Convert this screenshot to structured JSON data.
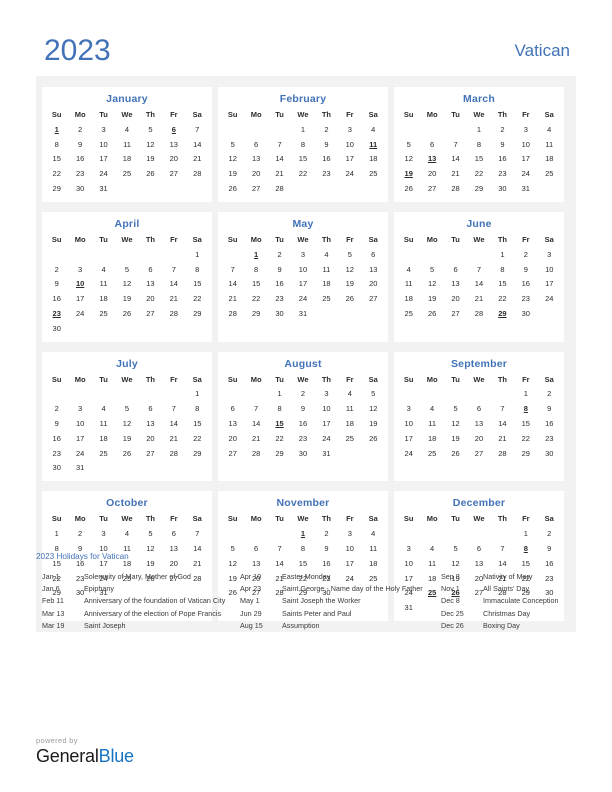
{
  "header": {
    "year": "2023",
    "country": "Vatican"
  },
  "colors": {
    "accent_blue": "#4272b8",
    "holiday_red": "#e3000f",
    "panel_bg": "#f2f2f2",
    "card_bg": "#ffffff",
    "brand_blue": "#1673c4"
  },
  "weekdays": [
    "Su",
    "Mo",
    "Tu",
    "We",
    "Th",
    "Fr",
    "Sa"
  ],
  "months": [
    {
      "name": "January",
      "lead_blanks": 0,
      "days": 31,
      "holidays": [
        1,
        6
      ]
    },
    {
      "name": "February",
      "lead_blanks": 3,
      "days": 28,
      "holidays": [
        11
      ]
    },
    {
      "name": "March",
      "lead_blanks": 3,
      "days": 31,
      "holidays": [
        13,
        19
      ]
    },
    {
      "name": "April",
      "lead_blanks": 6,
      "days": 30,
      "holidays": [
        10,
        23
      ]
    },
    {
      "name": "May",
      "lead_blanks": 1,
      "days": 31,
      "holidays": [
        1
      ]
    },
    {
      "name": "June",
      "lead_blanks": 4,
      "days": 30,
      "holidays": [
        29
      ]
    },
    {
      "name": "July",
      "lead_blanks": 6,
      "days": 31,
      "holidays": []
    },
    {
      "name": "August",
      "lead_blanks": 2,
      "days": 31,
      "holidays": [
        15
      ]
    },
    {
      "name": "September",
      "lead_blanks": 5,
      "days": 30,
      "holidays": [
        8
      ]
    },
    {
      "name": "October",
      "lead_blanks": 0,
      "days": 31,
      "holidays": []
    },
    {
      "name": "November",
      "lead_blanks": 3,
      "days": 30,
      "holidays": [
        1
      ]
    },
    {
      "name": "December",
      "lead_blanks": 5,
      "days": 31,
      "holidays": [
        8,
        25,
        26
      ]
    }
  ],
  "holidays_section": {
    "title": "2023 Holidays for Vatican",
    "columns": [
      [
        {
          "date": "Jan 1",
          "name": "Solemnity of Mary, Mother of God"
        },
        {
          "date": "Jan 6",
          "name": "Epiphany"
        },
        {
          "date": "Feb 11",
          "name": "Anniversary of the foundation of Vatican City"
        },
        {
          "date": "Mar 13",
          "name": "Anniversary of the election of Pope Francis"
        },
        {
          "date": "Mar 19",
          "name": "Saint Joseph"
        }
      ],
      [
        {
          "date": "Apr 10",
          "name": "Easter Monday"
        },
        {
          "date": "Apr 23",
          "name": "Saint George - Name day of the Holy Father"
        },
        {
          "date": "May 1",
          "name": "Saint Joseph the Worker"
        },
        {
          "date": "Jun 29",
          "name": "Saints Peter and Paul"
        },
        {
          "date": "Aug 15",
          "name": "Assumption"
        }
      ],
      [
        {
          "date": "Sep 8",
          "name": "Nativity of Mary"
        },
        {
          "date": "Nov 1",
          "name": "All Saints’ Day"
        },
        {
          "date": "Dec 8",
          "name": "Immaculate Conception"
        },
        {
          "date": "Dec 25",
          "name": "Christmas Day"
        },
        {
          "date": "Dec 26",
          "name": "Boxing Day"
        }
      ]
    ]
  },
  "footer": {
    "powered_by": "powered by",
    "brand_first": "General",
    "brand_second": "Blue"
  }
}
